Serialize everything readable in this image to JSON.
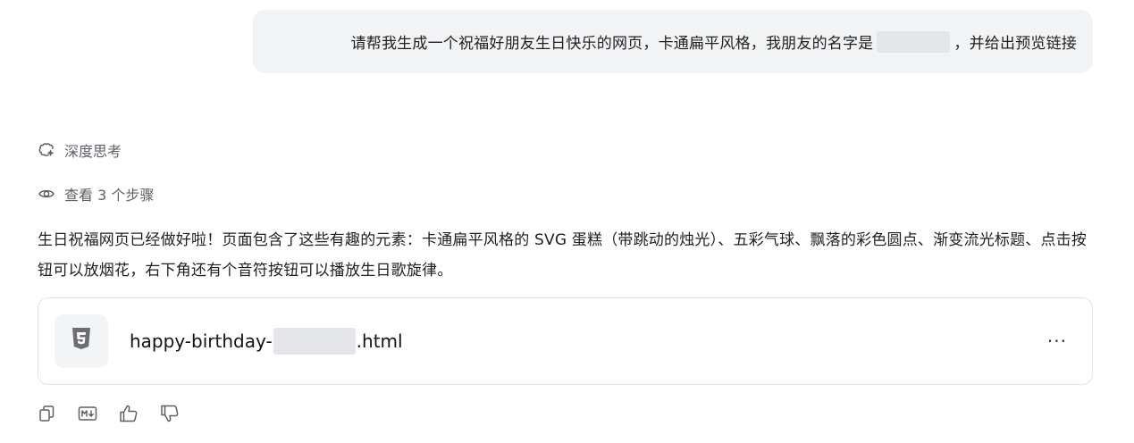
{
  "user_message": {
    "before_name": "请帮我生成一个祝福好朋友生日快乐的网页，卡通扁平风格，我朋友的名字是",
    "after_name": "，并给出预览链接"
  },
  "deep_thinking": {
    "label": "深度思考",
    "icon": "sparkle-brain-icon"
  },
  "steps": {
    "label": "查看 3 个步骤",
    "icon": "eye-icon"
  },
  "answer": {
    "text": "生日祝福网页已经做好啦！页面包含了这些有趣的元素：卡通扁平风格的 SVG 蛋糕（带跳动的烛光）、五彩气球、飘落的彩色圆点、渐变流光标题、点击按钮可以放烟花，右下角还有个音符按钮可以播放生日歌旋律。"
  },
  "file_card": {
    "name_prefix": "happy-birthday-",
    "name_suffix": ".html",
    "icon": "html5-icon",
    "more_label": "···"
  },
  "action_bar": {
    "icons": [
      "copy-icon",
      "markdown-icon",
      "thumbs-up-icon",
      "thumbs-down-icon"
    ]
  },
  "colors": {
    "bubble_bg": "#f2f3f5",
    "muted_text": "#5e6066",
    "border": "#e3e4e6",
    "redaction": "#e4e5e8"
  }
}
